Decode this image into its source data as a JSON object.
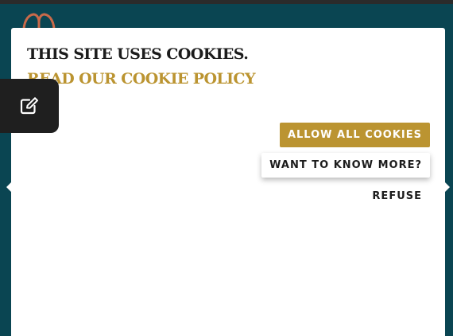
{
  "cookie_banner": {
    "title": "THIS SITE USES COOKIES.",
    "policy_link": "READ OUR COOKIE POLICY",
    "allow_all_label": "ALLOW ALL COOKIES",
    "know_more_label": "WANT TO KNOW MORE?",
    "refuse_label": "REFUSE"
  },
  "icons": {
    "edit_tab": "edit-icon",
    "logo": "site-logo",
    "nav_prev": "arrow-left-icon",
    "nav_next": "arrow-right-icon"
  },
  "colors": {
    "page_background": "#0a4552",
    "accent_gold": "#bb9431",
    "text_dark": "#1c1c1c",
    "edit_tab_background": "#1f1f1f",
    "logo_color": "#c96a4a"
  }
}
